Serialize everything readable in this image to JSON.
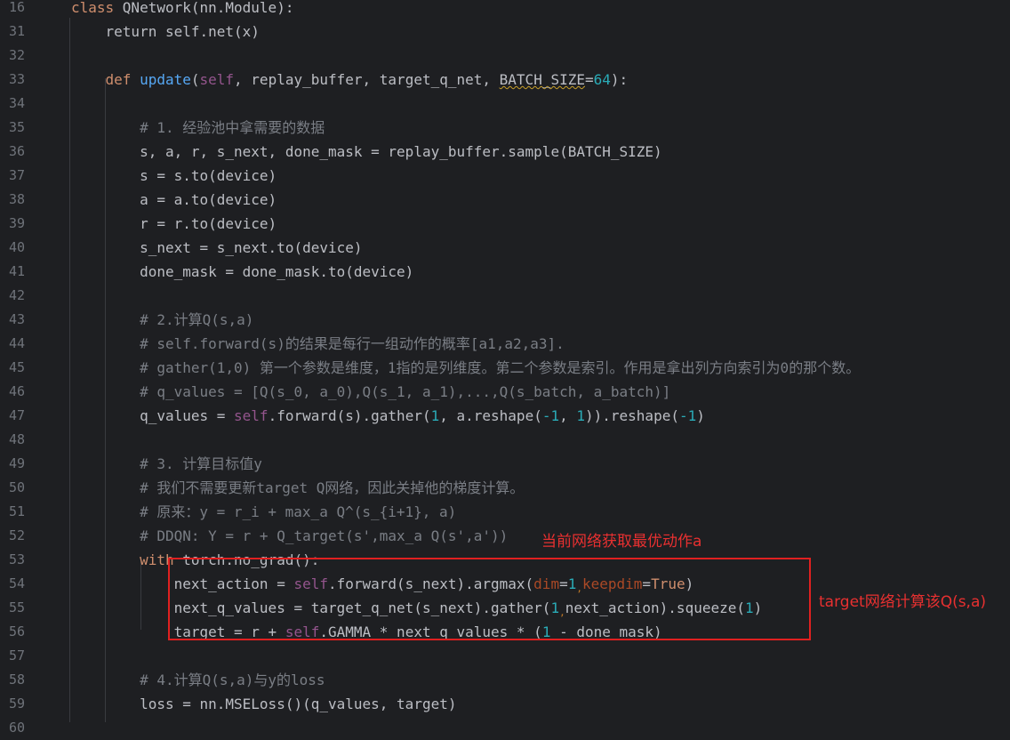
{
  "editor": {
    "lines": [
      {
        "n": "16",
        "segs": [
          [
            "kw",
            "class "
          ],
          [
            "plain",
            "QNetwork(nn.Module):"
          ]
        ]
      },
      {
        "n": "31",
        "segs": [
          [
            "plain",
            "    return self.net(x)"
          ]
        ]
      },
      {
        "n": "32",
        "segs": []
      },
      {
        "n": "33",
        "segs": [
          [
            "plain",
            "    "
          ],
          [
            "kw",
            "def "
          ],
          [
            "fn",
            "update"
          ],
          [
            "plain",
            "("
          ],
          [
            "self",
            "self"
          ],
          [
            "plain",
            ", replay_buffer, target_q_net, "
          ],
          [
            "warn",
            "BATCH_SIZE"
          ],
          [
            "plain",
            "="
          ],
          [
            "num",
            "64"
          ],
          [
            "plain",
            "):"
          ]
        ]
      },
      {
        "n": "34",
        "segs": []
      },
      {
        "n": "35",
        "segs": [
          [
            "cm",
            "        # 1. 经验池中拿需要的数据"
          ]
        ]
      },
      {
        "n": "36",
        "segs": [
          [
            "plain",
            "        s, a, r, s_next, done_mask = replay_buffer.sample(BATCH_SIZE)"
          ]
        ]
      },
      {
        "n": "37",
        "segs": [
          [
            "plain",
            "        s = s.to(device)"
          ]
        ]
      },
      {
        "n": "38",
        "segs": [
          [
            "plain",
            "        a = a.to(device)"
          ]
        ]
      },
      {
        "n": "39",
        "segs": [
          [
            "plain",
            "        r = r.to(device)"
          ]
        ]
      },
      {
        "n": "40",
        "segs": [
          [
            "plain",
            "        s_next = s_next.to(device)"
          ]
        ]
      },
      {
        "n": "41",
        "segs": [
          [
            "plain",
            "        done_mask = done_mask.to(device)"
          ]
        ]
      },
      {
        "n": "42",
        "segs": []
      },
      {
        "n": "43",
        "segs": [
          [
            "cm",
            "        # 2.计算Q(s,a)"
          ]
        ]
      },
      {
        "n": "44",
        "segs": [
          [
            "cm",
            "        # self.forward(s)的结果是每行一组动作的概率[a1,a2,a3]."
          ]
        ]
      },
      {
        "n": "45",
        "segs": [
          [
            "cm",
            "        # gather(1,0) 第一个参数是维度，1指的是列维度。第二个参数是索引。作用是拿出列方向索引为0的那个数。"
          ]
        ]
      },
      {
        "n": "46",
        "segs": [
          [
            "cm",
            "        # q_values = [Q(s_0, a_0),Q(s_1, a_1),...,Q(s_batch, a_batch)]"
          ]
        ]
      },
      {
        "n": "47",
        "segs": [
          [
            "plain",
            "        q_values = "
          ],
          [
            "self",
            "self"
          ],
          [
            "plain",
            ".forward(s).gather("
          ],
          [
            "num",
            "1"
          ],
          [
            "plain",
            ", a.reshape("
          ],
          [
            "num",
            "-1"
          ],
          [
            "plain",
            ", "
          ],
          [
            "num",
            "1"
          ],
          [
            "plain",
            ")).reshape("
          ],
          [
            "num",
            "-1"
          ],
          [
            "plain",
            ")"
          ]
        ]
      },
      {
        "n": "48",
        "segs": []
      },
      {
        "n": "49",
        "segs": [
          [
            "cm",
            "        # 3. 计算目标值y"
          ]
        ]
      },
      {
        "n": "50",
        "segs": [
          [
            "cm",
            "        # 我们不需要更新target Q网络，因此关掉他的梯度计算。"
          ]
        ]
      },
      {
        "n": "51",
        "segs": [
          [
            "cm",
            "        # 原来：y = r_i + max_a Q^(s_{i+1}, a)"
          ]
        ]
      },
      {
        "n": "52",
        "segs": [
          [
            "cm",
            "        # DDQN: Y = r + Q_target(s',max_a Q(s',a'))"
          ]
        ]
      },
      {
        "n": "53",
        "segs": [
          [
            "plain",
            "        "
          ],
          [
            "kw",
            "with "
          ],
          [
            "plain",
            "torch.no_grad():"
          ]
        ]
      },
      {
        "n": "54",
        "segs": [
          [
            "plain",
            "            next_action = "
          ],
          [
            "self",
            "self"
          ],
          [
            "plain",
            ".forward(s_next).argmax("
          ],
          [
            "nm",
            "dim"
          ],
          [
            "plain",
            "="
          ],
          [
            "num",
            "1"
          ],
          [
            "hint",
            ","
          ],
          [
            "nm",
            "keepdim"
          ],
          [
            "plain",
            "="
          ],
          [
            "kw",
            "True"
          ],
          [
            "plain",
            ")"
          ]
        ]
      },
      {
        "n": "55",
        "segs": [
          [
            "plain",
            "            next_q_values = target_q_net(s_next).gather("
          ],
          [
            "num",
            "1"
          ],
          [
            "hint",
            ","
          ],
          [
            "plain",
            "next_action).squeeze("
          ],
          [
            "num",
            "1"
          ],
          [
            "plain",
            ")"
          ]
        ]
      },
      {
        "n": "56",
        "segs": [
          [
            "plain",
            "            target = r + "
          ],
          [
            "self",
            "self"
          ],
          [
            "plain",
            ".GAMMA * next_q_values * ("
          ],
          [
            "num",
            "1"
          ],
          [
            "plain",
            " - done_mask)"
          ]
        ]
      },
      {
        "n": "57",
        "segs": []
      },
      {
        "n": "58",
        "segs": [
          [
            "cm",
            "        # 4.计算Q(s,a)与y的loss"
          ]
        ]
      },
      {
        "n": "59",
        "segs": [
          [
            "plain",
            "        loss = nn.MSELoss()(q_values, target)"
          ]
        ]
      },
      {
        "n": "60",
        "segs": []
      }
    ]
  },
  "annotations": {
    "note_top": "当前网络获取最优动作a",
    "note_right": "target网络计算该Q(s,a)"
  },
  "colors": {
    "background": "#1e1f22",
    "keyword": "#cf8e6d",
    "function": "#56a8f5",
    "self": "#94558d",
    "number": "#2aacb8",
    "comment": "#7a7e85",
    "annotation": "#e83030"
  }
}
